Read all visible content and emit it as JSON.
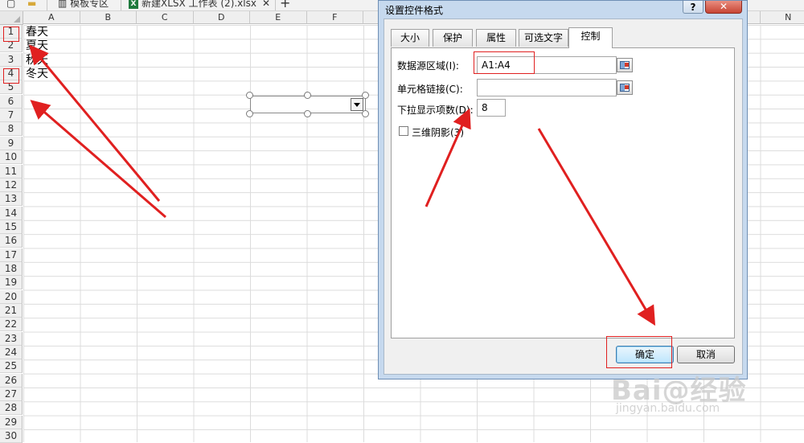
{
  "tabbar": {
    "tabs": [
      "模板专区",
      "新建XLSX 工作表 (2).xlsx"
    ],
    "close_glyph": "✕",
    "new_tab_glyph": "+",
    "excel_badge": "X"
  },
  "sheet": {
    "columns": [
      "A",
      "B",
      "C",
      "D",
      "E",
      "F",
      "",
      "",
      "",
      "",
      "",
      "",
      "",
      "N"
    ],
    "rows": [
      "1",
      "2",
      "3",
      "4",
      "5",
      "6",
      "7",
      "8",
      "9",
      "10",
      "11",
      "12",
      "13",
      "14",
      "15",
      "16",
      "17",
      "18",
      "19",
      "20",
      "21",
      "22",
      "23",
      "24",
      "25",
      "26",
      "27",
      "28",
      "29",
      "30"
    ],
    "cells": [
      "春天",
      "夏天",
      "秋天",
      "冬天"
    ]
  },
  "dialog": {
    "title": "设置控件格式",
    "help_label": "?",
    "close_label": "✕",
    "tabs": [
      "大小",
      "保护",
      "属性",
      "可选文字",
      "控制"
    ],
    "active_tab": "控制",
    "source_range_label": "数据源区域(I):",
    "source_range_value": "A1:A4",
    "cell_link_label": "单元格链接(C):",
    "cell_link_value": "",
    "dropdown_lines_label": "下拉显示项数(D):",
    "dropdown_lines_value": "8",
    "shading_3d_label": "三维阴影(3)",
    "ok_label": "确定",
    "cancel_label": "取消"
  },
  "watermark": {
    "main": "Bai@经验",
    "sub": "jingyan.baidu.com"
  },
  "colors": {
    "annotation": "#e02020",
    "dialog_frame": "#c6d9ee",
    "excel_green": "#1f7a3e"
  }
}
